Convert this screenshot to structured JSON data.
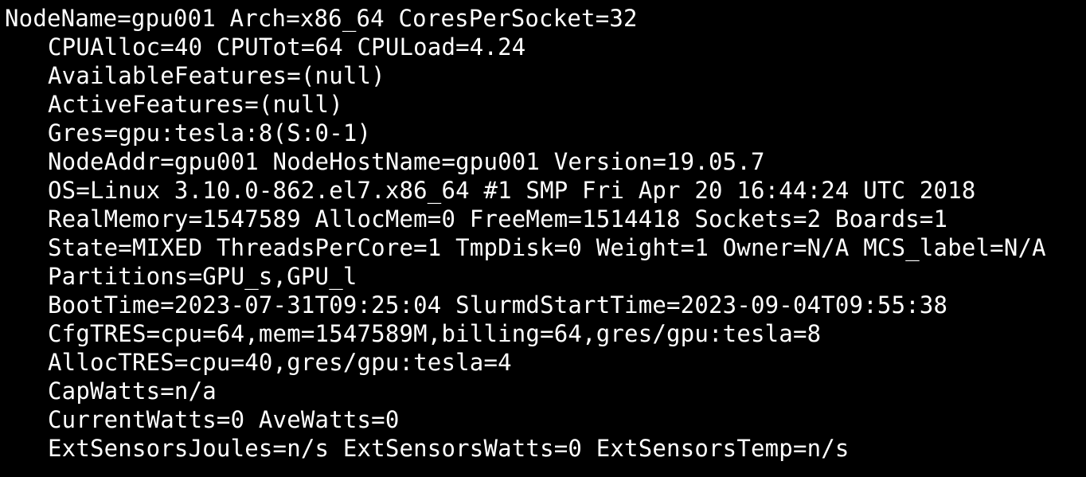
{
  "terminal": {
    "colors": {
      "background": "#000000",
      "foreground": "#ffffff"
    },
    "lines": [
      "NodeName=gpu001 Arch=x86_64 CoresPerSocket=32",
      "CPUAlloc=40 CPUTot=64 CPULoad=4.24",
      "AvailableFeatures=(null)",
      "ActiveFeatures=(null)",
      "Gres=gpu:tesla:8(S:0-1)",
      "NodeAddr=gpu001 NodeHostName=gpu001 Version=19.05.7",
      "OS=Linux 3.10.0-862.el7.x86_64 #1 SMP Fri Apr 20 16:44:24 UTC 2018",
      "RealMemory=1547589 AllocMem=0 FreeMem=1514418 Sockets=2 Boards=1",
      "State=MIXED ThreadsPerCore=1 TmpDisk=0 Weight=1 Owner=N/A MCS_label=N/A",
      "Partitions=GPU_s,GPU_l",
      "BootTime=2023-07-31T09:25:04 SlurmdStartTime=2023-09-04T09:55:38",
      "CfgTRES=cpu=64,mem=1547589M,billing=64,gres/gpu:tesla=8",
      "AllocTRES=cpu=40,gres/gpu:tesla=4",
      "CapWatts=n/a",
      "CurrentWatts=0 AveWatts=0",
      "ExtSensorsJoules=n/s ExtSensorsWatts=0 ExtSensorsTemp=n/s"
    ]
  }
}
